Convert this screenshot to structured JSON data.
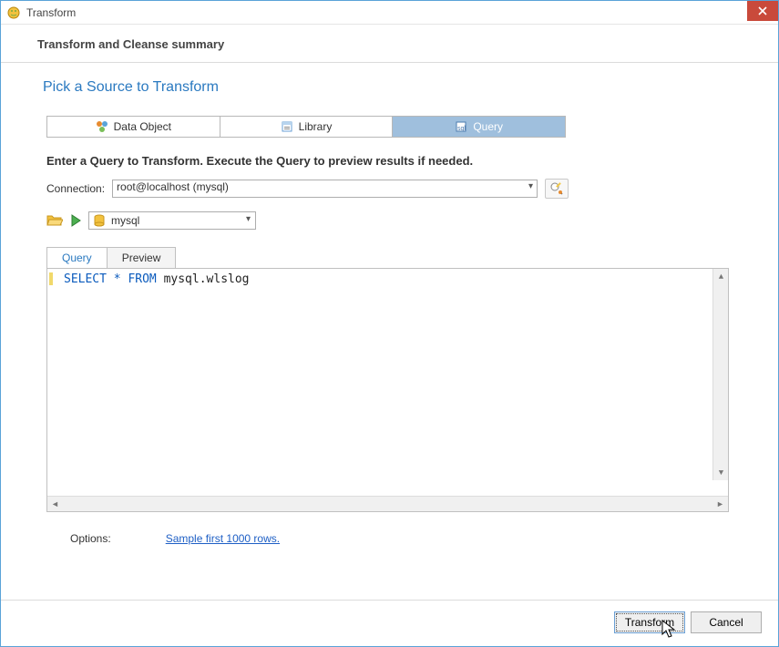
{
  "window": {
    "title": "Transform"
  },
  "header": {
    "subtitle": "Transform and Cleanse summary"
  },
  "section": {
    "heading": "Pick a Source to Transform"
  },
  "sourceTabs": {
    "items": [
      {
        "label": "Data Object"
      },
      {
        "label": "Library"
      },
      {
        "label": "Query"
      }
    ],
    "activeIndex": 2
  },
  "instruction": "Enter a Query to Transform.  Execute the Query to preview results if needed.",
  "connection": {
    "label": "Connection:",
    "value": "root@localhost (mysql)"
  },
  "database": {
    "value": "mysql"
  },
  "editorTabs": {
    "items": [
      {
        "label": "Query"
      },
      {
        "label": "Preview"
      }
    ],
    "activeIndex": 0
  },
  "query": {
    "keywords": "SELECT * FROM",
    "rest": "mysql.wlslog"
  },
  "options": {
    "label": "Options:",
    "sample_link": "Sample first 1000 rows."
  },
  "buttons": {
    "transform": "Transform",
    "cancel": "Cancel"
  }
}
